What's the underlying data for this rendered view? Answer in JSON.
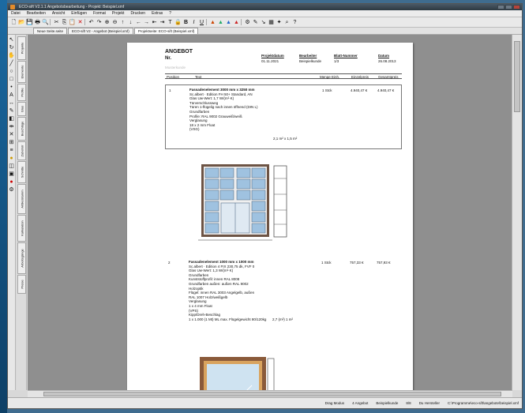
{
  "window": {
    "title": "ECO-sift V2.1.1 Angebotsbearbeitung - Projekt: Beispiel.xmf"
  },
  "menu": [
    "Datei",
    "Bearbeiten",
    "Ansicht",
    "Einfügen",
    "Format",
    "Projekt",
    "Drucken",
    "Extras",
    "?"
  ],
  "tabs": [
    {
      "label": "Neue Seite.seite",
      "active": false
    },
    {
      "label": "ECO-sift V2 - Angebot (Beispiel.xmf)",
      "active": false
    },
    {
      "label": "Projektseite: ECO-sift (Beispiel.xmf)",
      "active": true
    }
  ],
  "side_tabs": [
    "Projekte",
    "Elemente",
    "Profile",
    "Glas",
    "Beschläge",
    "Zubehör",
    "Schnitte",
    "Artikelstamm",
    "Kalkulation",
    "Arbeitsgänge",
    "Preise"
  ],
  "document": {
    "title": "ANGEBOT",
    "nr_label": "Nr.",
    "faint_line": "Musterkunde",
    "header_fields": [
      {
        "label": "Projektdatum",
        "value": "01.11.2021"
      },
      {
        "label": "Bearbeiter",
        "value": "Beispielkunde"
      },
      {
        "label": "Blatt-Nummer",
        "value": "1/3"
      },
      {
        "label": "Datum",
        "value": "26.08.2013"
      }
    ],
    "columns": [
      "Position",
      "Text",
      "Menge Einh.",
      "Einzelpreis",
      "Gesamtpreis"
    ],
    "positions": [
      {
        "pos": "1",
        "title": "Fassadenelement 3000 mm x 3250 mm",
        "lines": [
          "Sc.albert · Edition FH 50+ Standard, AN",
          "Glas Uw-Wert: 1,7 W/(m²·K)",
          "Türverschlussweg",
          "Türen 1-flügelig nach innen öffnend (DIN L)",
          "Grundfarben",
          "Profile: RAL 9002 Grauweiß/weiß",
          "Verglasung",
          "18 x 2 mm Float",
          "(VSG)"
        ],
        "glass_extra": "2,1 m² x 1,5 m²",
        "qty": "1 Stck",
        "unit_price": "4.940,47 €",
        "total": "4.940,47 €"
      },
      {
        "pos": "2",
        "title": "Fassadenelement 1000 mm x 1000 mm",
        "lines": [
          "Sc.albert · Edition 4 FIX 230,75 dk, FVF 0",
          "Glas Uw-Wert: 1,3 W/(m²·K)",
          "Grundfarben",
          "Kunststoffprofil: innen RAL 8008",
          "Grundfarben außen: außen RAL 9002",
          "Holzoptik",
          "Flügel: innen RAL 3003 Angelgelb, außen",
          "RAL 1007 Holz/weißgelb",
          "Verglasung",
          "1 x 4 mm Float",
          "(VPS)",
          "Kipp/Dreh-Beschlag",
          "1 x 1.000 (1 Mt) ML max. Flügelgewicht 80/120kg"
        ],
        "glass_extra": "2,7 (m²) 1 m²",
        "qty": "1 Stck",
        "unit_price": "757,33 €",
        "total": "757,93 €"
      }
    ]
  },
  "status": [
    "Drag Modus",
    "4 Angebot",
    "Beispielkunde",
    "8/8",
    "Du Hersteller",
    "C:\\Programme\\eco-sift\\angebote\\beispiel.xmf"
  ]
}
